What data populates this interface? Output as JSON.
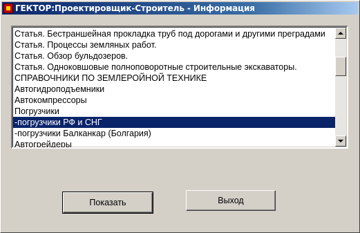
{
  "window": {
    "title": "ГЕКТОР:Проектировщик-Строитель - Информация",
    "icon": "app-icon"
  },
  "list": {
    "selected_index": 9,
    "items": [
      "Статья. Бестраншейная прокладка труб под дорогами и другими преградами",
      "Статья. Процессы земляных работ.",
      "Статья. Обзор бульдозеров.",
      "Статья. Одноковшовые полноповоротные строительные экскаваторы.",
      "СПРАВОЧНИКИ ПО ЗЕМЛЕРОЙНОЙ ТЕХНИКЕ",
      "Автогидроподъемники",
      "Автокомпрессоры",
      "Погрузчики",
      "-погрузчики РФ и СНГ",
      "-погрузчики Балканкар (Болгария)",
      "Автогрейдеры"
    ]
  },
  "buttons": {
    "show_label": "Показать",
    "exit_label": "Выход"
  },
  "colors": {
    "selection_bg": "#0a246a",
    "titlebar_start": "#0a246a",
    "face": "#d4d0c8"
  }
}
